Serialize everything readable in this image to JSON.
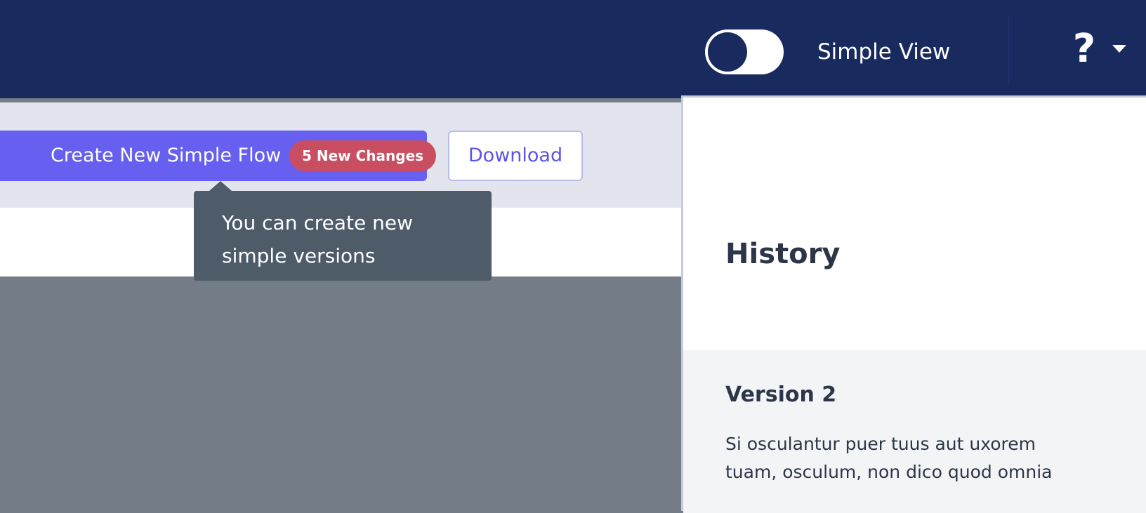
{
  "header": {
    "view_label": "Simple View",
    "help_icon": "?",
    "toggle_state": "off"
  },
  "toolbar": {
    "create_label": "Create New Simple Flow",
    "badge_label": "5 New Changes",
    "download_label": "Download"
  },
  "tooltip": {
    "text": "You can create new simple versions"
  },
  "panel": {
    "title": "History",
    "versions": [
      {
        "title": "Version 2",
        "description": "Si osculantur puer tuus aut uxorem tuam, osculum, non dico quod omnia"
      }
    ]
  },
  "colors": {
    "topbar": "#192a5e",
    "primary": "#675ff0",
    "badge": "#c94e61",
    "tooltip": "#4e5c6a",
    "overlay": "#747d87"
  }
}
